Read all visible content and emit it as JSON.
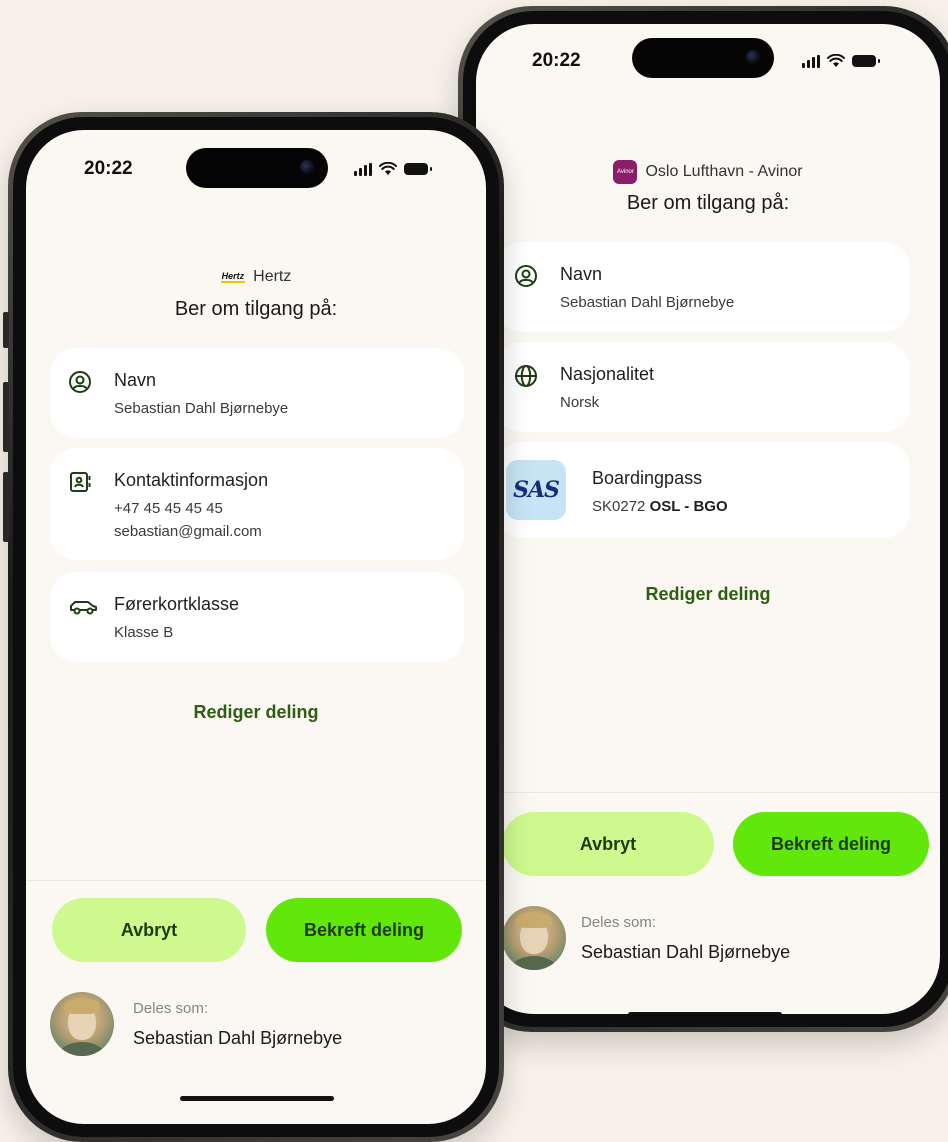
{
  "colors": {
    "background": "#f6f1e9",
    "screen": "#fbf8f3",
    "card": "#ffffff",
    "cancel_button": "#cdf98f",
    "confirm_button": "#62e70b",
    "edit_link": "#2d5e12",
    "avinor_brand": "#8b1d6b",
    "sas_tile": "#c7e4f4"
  },
  "front_phone": {
    "status": {
      "time": "20:22"
    },
    "app": {
      "logo_text": "Hertz",
      "name": "Hertz"
    },
    "heading": "Ber om tilgang på:",
    "items": [
      {
        "icon": "user-circle-icon",
        "title": "Navn",
        "lines": [
          "Sebastian Dahl Bjørnebye"
        ]
      },
      {
        "icon": "contact-card-icon",
        "title": "Kontaktinformasjon",
        "lines": [
          "+47 45 45 45 45",
          "sebastian@gmail.com"
        ]
      },
      {
        "icon": "car-icon",
        "title": "Førerkortklasse",
        "lines": [
          "Klasse B"
        ]
      }
    ],
    "edit_link": "Rediger deling",
    "buttons": {
      "cancel": "Avbryt",
      "confirm": "Bekreft deling"
    },
    "shared_as": {
      "label": "Deles som:",
      "name": "Sebastian Dahl Bjørnebye"
    }
  },
  "back_phone": {
    "status": {
      "time": "20:22"
    },
    "app": {
      "logo_text": "Avinor",
      "name": "Oslo Lufthavn - Avinor"
    },
    "heading": "Ber om tilgang på:",
    "items": [
      {
        "icon": "user-circle-icon",
        "title": "Navn",
        "lines": [
          "Sebastian Dahl Bjørnebye"
        ]
      },
      {
        "icon": "globe-icon",
        "title": "Nasjonalitet",
        "lines": [
          "Norsk"
        ]
      },
      {
        "icon": "sas-logo",
        "logo_text": "SAS",
        "title": "Boardingpass",
        "flight": "SK0272",
        "route": "OSL - BGO"
      }
    ],
    "edit_link": "Rediger deling",
    "buttons": {
      "cancel": "Avbryt",
      "confirm": "Bekreft deling"
    },
    "shared_as": {
      "label": "Deles som:",
      "name": "Sebastian Dahl Bjørnebye"
    }
  }
}
